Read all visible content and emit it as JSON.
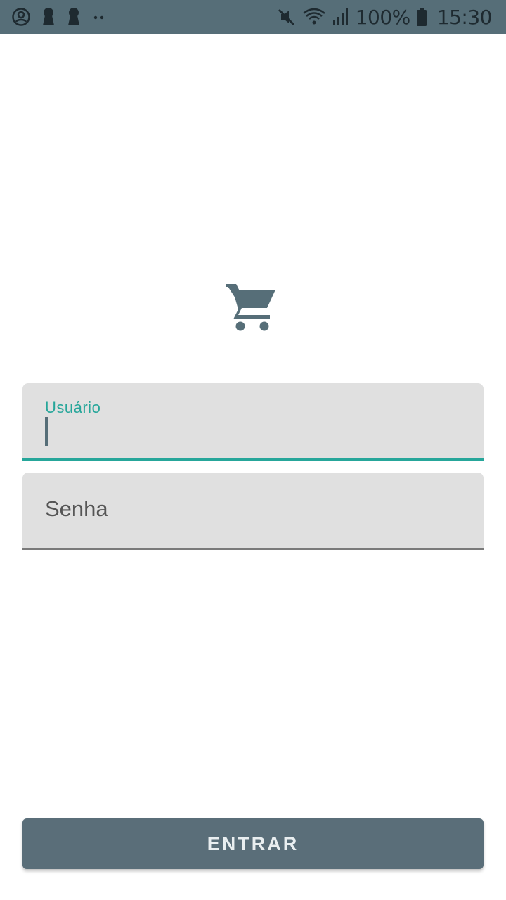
{
  "status_bar": {
    "battery_percent": "100%",
    "time": "15:30",
    "left_icons": [
      "account-circle-icon",
      "keyhole-icon",
      "keyhole-icon",
      "more-dots-icon"
    ],
    "right_icons": [
      "mute-icon",
      "wifi-icon",
      "signal-icon",
      "battery-icon"
    ],
    "background": "#566e78"
  },
  "logo": {
    "icon": "shopping-cart-icon",
    "color": "#566e78"
  },
  "form": {
    "username": {
      "label": "Usuário",
      "value": "",
      "focused": true,
      "accent": "#26a69a"
    },
    "password": {
      "label": "Senha",
      "value": ""
    }
  },
  "login_button": {
    "label": "ENTRAR",
    "color": "#5a6e79"
  }
}
